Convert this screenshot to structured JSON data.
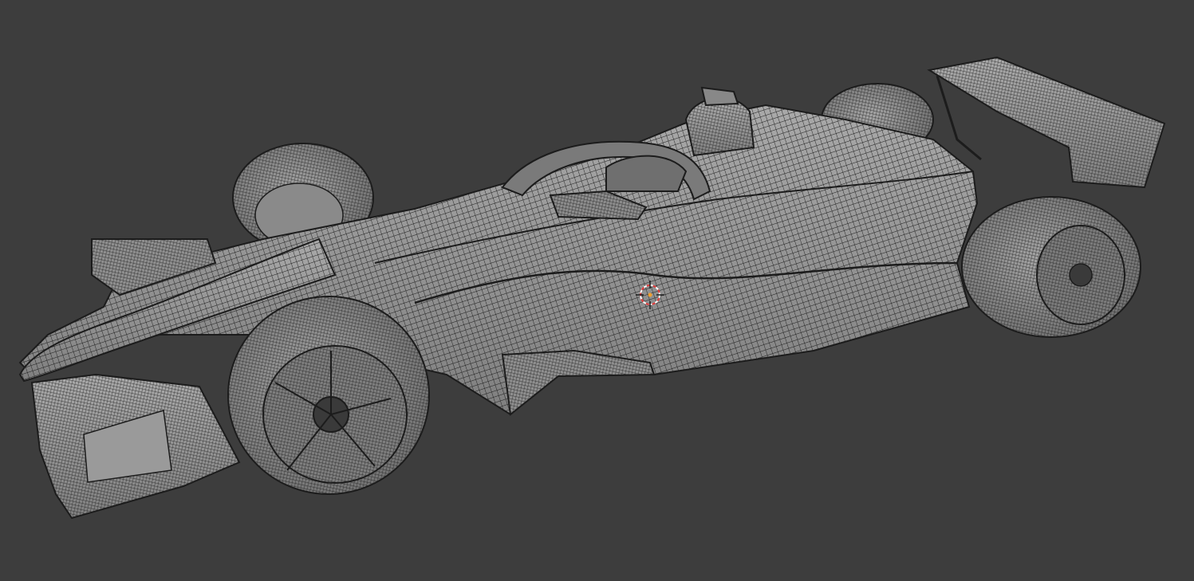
{
  "viewport": {
    "background_color": "#3d3d3d",
    "mesh_shade_color": "#8c8c8c",
    "mesh_light_color": "#a9a9a9",
    "wire_color": "#1c1c1c",
    "cursor_colors": [
      "#e23a3a",
      "#ffffff"
    ]
  },
  "scene_object": {
    "icon": "wireframe-race-car-icon"
  },
  "cursor": {
    "icon": "3d-cursor-icon"
  }
}
